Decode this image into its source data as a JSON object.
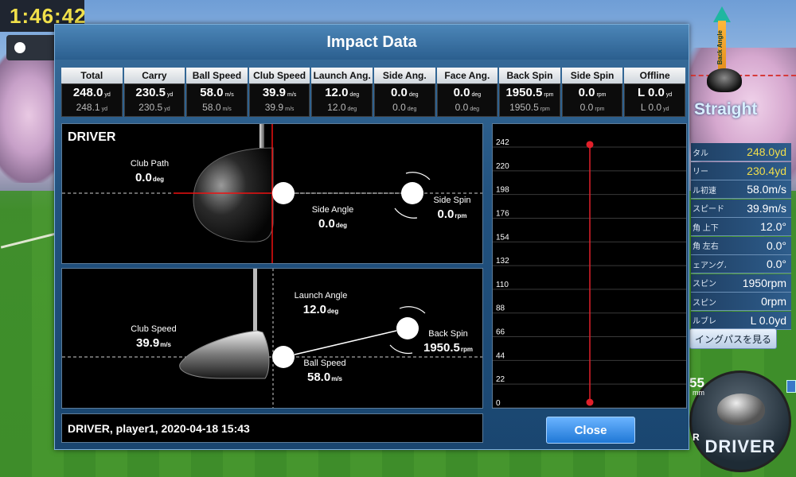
{
  "clock": "1:46:42",
  "ball_count": "2",
  "hud": {
    "aim_text": "Back Angle",
    "straight": "Straight",
    "rows": [
      {
        "k": "タル",
        "v": "248.0yd",
        "hl": true
      },
      {
        "k": "リー",
        "v": "230.4yd",
        "hl": true
      },
      {
        "k": "ル初速",
        "v": "58.0m/s",
        "hl": false
      },
      {
        "k": "スピード",
        "v": "39.9m/s",
        "hl": false
      },
      {
        "k": "角 上下",
        "v": "12.0°",
        "hl": false
      },
      {
        "k": "角 左右",
        "v": "0.0°",
        "hl": false
      },
      {
        "k": "ェアングル",
        "v": "0.0°",
        "hl": false
      },
      {
        "k": "スピン",
        "v": "1950rpm",
        "hl": false
      },
      {
        "k": "スピン",
        "v": "0rpm",
        "hl": false
      },
      {
        "k": "ルブレ",
        "v": "L 0.0yd",
        "hl": false
      }
    ],
    "swing_path_button": "イングパスを見る",
    "distance": "55",
    "distance_unit": "mm",
    "small_r": "R",
    "club": "DRIVER"
  },
  "dialog": {
    "title": "Impact Data",
    "stats": [
      {
        "label": "Total",
        "v1": "248.0",
        "v2": "248.1",
        "unit": "yd"
      },
      {
        "label": "Carry",
        "v1": "230.5",
        "v2": "230.5",
        "unit": "yd"
      },
      {
        "label": "Ball Speed",
        "v1": "58.0",
        "v2": "58.0",
        "unit": "m/s"
      },
      {
        "label": "Club Speed",
        "v1": "39.9",
        "v2": "39.9",
        "unit": "m/s"
      },
      {
        "label": "Launch Ang.",
        "v1": "12.0",
        "v2": "12.0",
        "unit": "deg"
      },
      {
        "label": "Side Ang.",
        "v1": "0.0",
        "v2": "0.0",
        "unit": "deg"
      },
      {
        "label": "Face Ang.",
        "v1": "0.0",
        "v2": "0.0",
        "unit": "deg"
      },
      {
        "label": "Back Spin",
        "v1": "1950.5",
        "v2": "1950.5",
        "unit": "rpm"
      },
      {
        "label": "Side Spin",
        "v1": "0.0",
        "v2": "0.0",
        "unit": "rpm"
      },
      {
        "label": "Offline",
        "v1": "L 0.0",
        "v2": "L 0.0",
        "unit": "yd"
      }
    ],
    "top_panel": {
      "club": "DRIVER",
      "club_path_label": "Club Path",
      "club_path_value": "0.0",
      "club_path_unit": "deg",
      "side_angle_label": "Side Angle",
      "side_angle_value": "0.0",
      "side_angle_unit": "deg",
      "side_spin_label": "Side Spin",
      "side_spin_value": "0.0",
      "side_spin_unit": "rpm"
    },
    "bottom_panel": {
      "club_speed_label": "Club Speed",
      "club_speed_value": "39.9",
      "club_speed_unit": "m/s",
      "launch_angle_label": "Launch Angle",
      "launch_angle_value": "12.0",
      "launch_angle_unit": "deg",
      "ball_speed_label": "Ball Speed",
      "ball_speed_value": "58.0",
      "ball_speed_unit": "m/s",
      "back_spin_label": "Back Spin",
      "back_spin_value": "1950.5",
      "back_spin_unit": "rpm"
    },
    "info": "DRIVER, player1, 2020-04-18 15:43",
    "close": "Close"
  },
  "chart_data": {
    "type": "line",
    "ticks": [
      242,
      220,
      198,
      176,
      154,
      132,
      110,
      88,
      66,
      44,
      22,
      0
    ],
    "ylim": [
      0,
      242
    ],
    "points": [
      {
        "x": 0,
        "y": 248
      },
      {
        "x": 0,
        "y": 0
      }
    ],
    "line_color": "#e0202a"
  }
}
